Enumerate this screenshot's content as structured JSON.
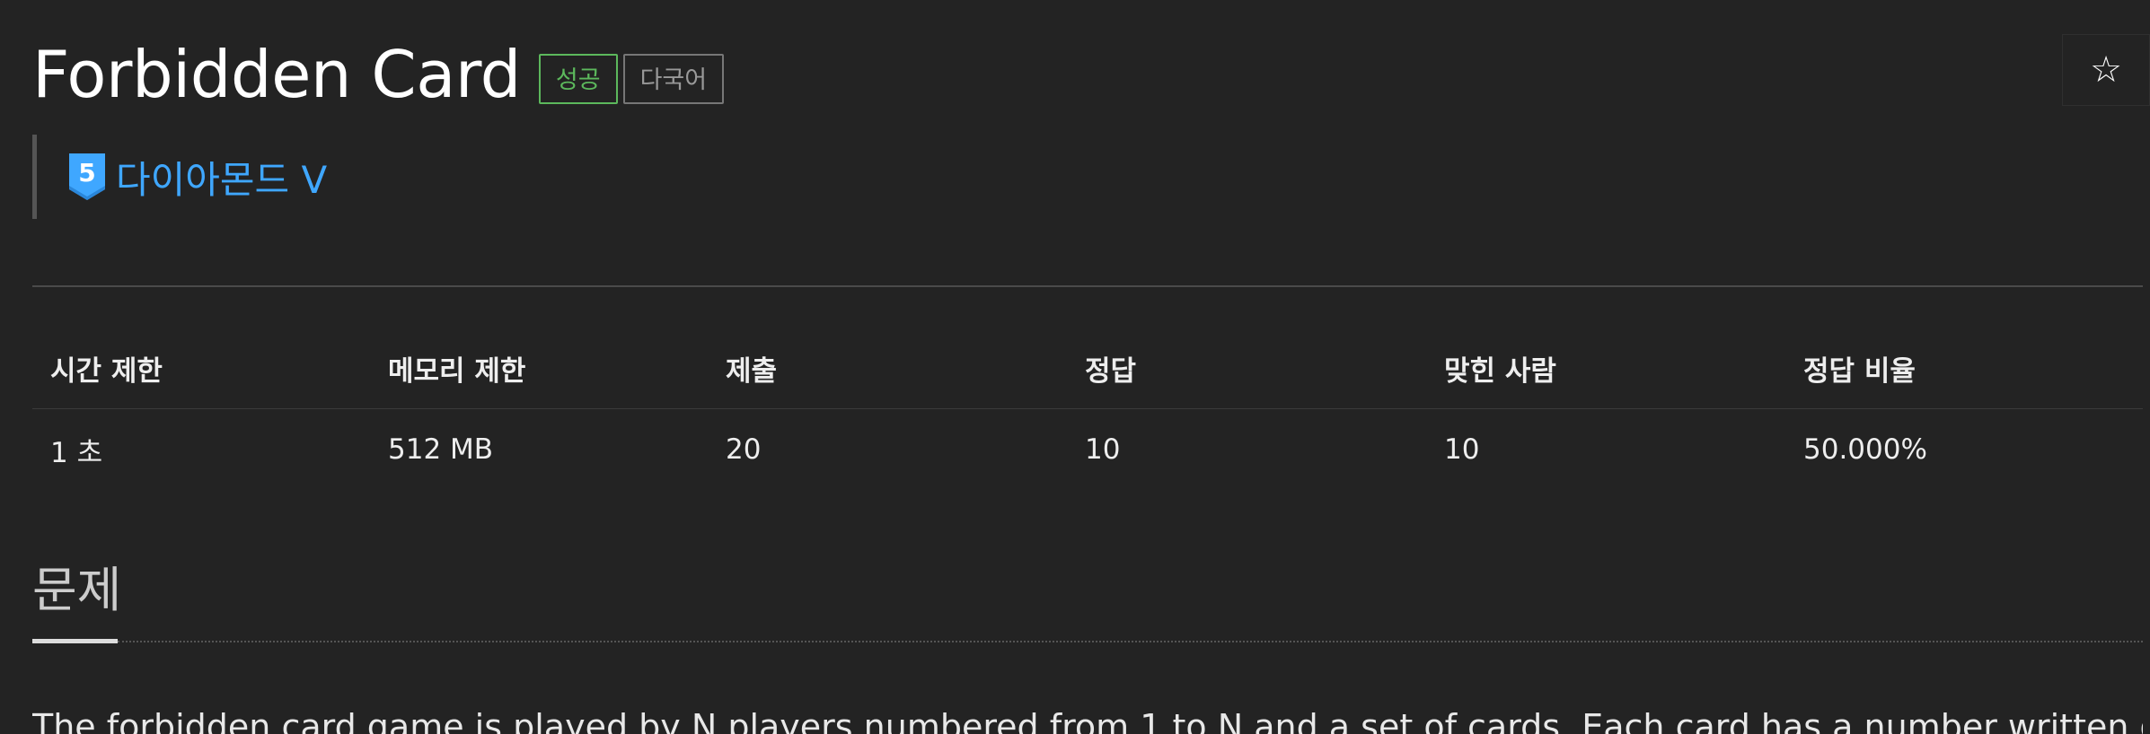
{
  "problem": {
    "title": "Forbidden Card",
    "badges": {
      "success": "성공",
      "multilang": "다국어"
    },
    "tier": {
      "label": "다이아몬드 V",
      "number": "5",
      "icon": "diamond-tier-icon",
      "color": "#3fa7ff"
    },
    "star_icon": "☆"
  },
  "info_table": {
    "headers": [
      "시간 제한",
      "메모리 제한",
      "제출",
      "정답",
      "맞힌 사람",
      "정답 비율"
    ],
    "row": [
      "1 초",
      "512 MB",
      "20",
      "10",
      "10",
      "50.000%"
    ]
  },
  "section": {
    "title": "문제",
    "text": "The forbidden card game is played by N players numbered from 1 to N and a set of cards. Each card has a number written on"
  },
  "colors": {
    "background": "#232323",
    "success": "#5cb85c",
    "tier": "#3fa7ff"
  }
}
